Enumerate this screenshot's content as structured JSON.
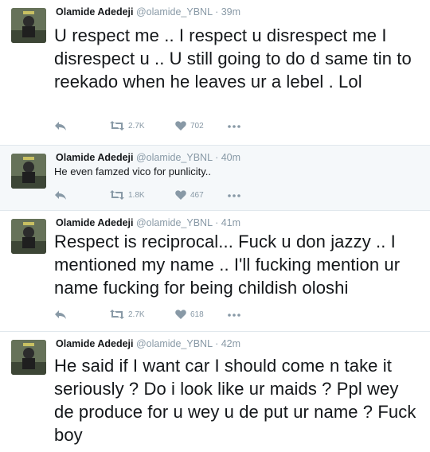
{
  "brand": {
    "muted": "#8899a6",
    "text": "#14171a",
    "divider": "#e1e8ed",
    "alt_bg": "#f5f8fa"
  },
  "tweets": [
    {
      "name": "Olamide Adedeji",
      "handle": "@olamide_YBNL",
      "time": "· 39m",
      "text": "U respect me .. I respect u disrespect me I disrespect u .. U still going to do d same tin to reekado when he leaves ur a lebel . Lol",
      "retweets": "2.7K",
      "likes": "702",
      "icons": [
        "reply-icon",
        "retweet-icon",
        "heart-icon",
        "more-icon"
      ]
    },
    {
      "name": "Olamide Adedeji",
      "handle": "@olamide_YBNL",
      "time": "· 40m",
      "text": "He even famzed vico for punlicity..",
      "retweets": "1.8K",
      "likes": "467",
      "icons": [
        "reply-icon",
        "retweet-icon",
        "heart-icon",
        "more-icon"
      ]
    },
    {
      "name": "Olamide Adedeji",
      "handle": "@olamide_YBNL",
      "time": "· 41m",
      "text": "Respect is reciprocal... Fuck u don jazzy .. I mentioned my name .. I'll fucking mention ur name fucking for being childish oloshi",
      "retweets": "2.7K",
      "likes": "618",
      "icons": [
        "reply-icon",
        "retweet-icon",
        "heart-icon",
        "more-icon"
      ]
    },
    {
      "name": "Olamide Adedeji",
      "handle": "@olamide_YBNL",
      "time": "· 42m",
      "text": "He said if I want car I should come n take it seriously ? Do i look like ur maids ? Ppl wey de produce for u wey u de put ur name ? Fuck boy",
      "icons": [
        "reply-icon",
        "retweet-icon",
        "heart-icon",
        "more-icon"
      ]
    }
  ]
}
